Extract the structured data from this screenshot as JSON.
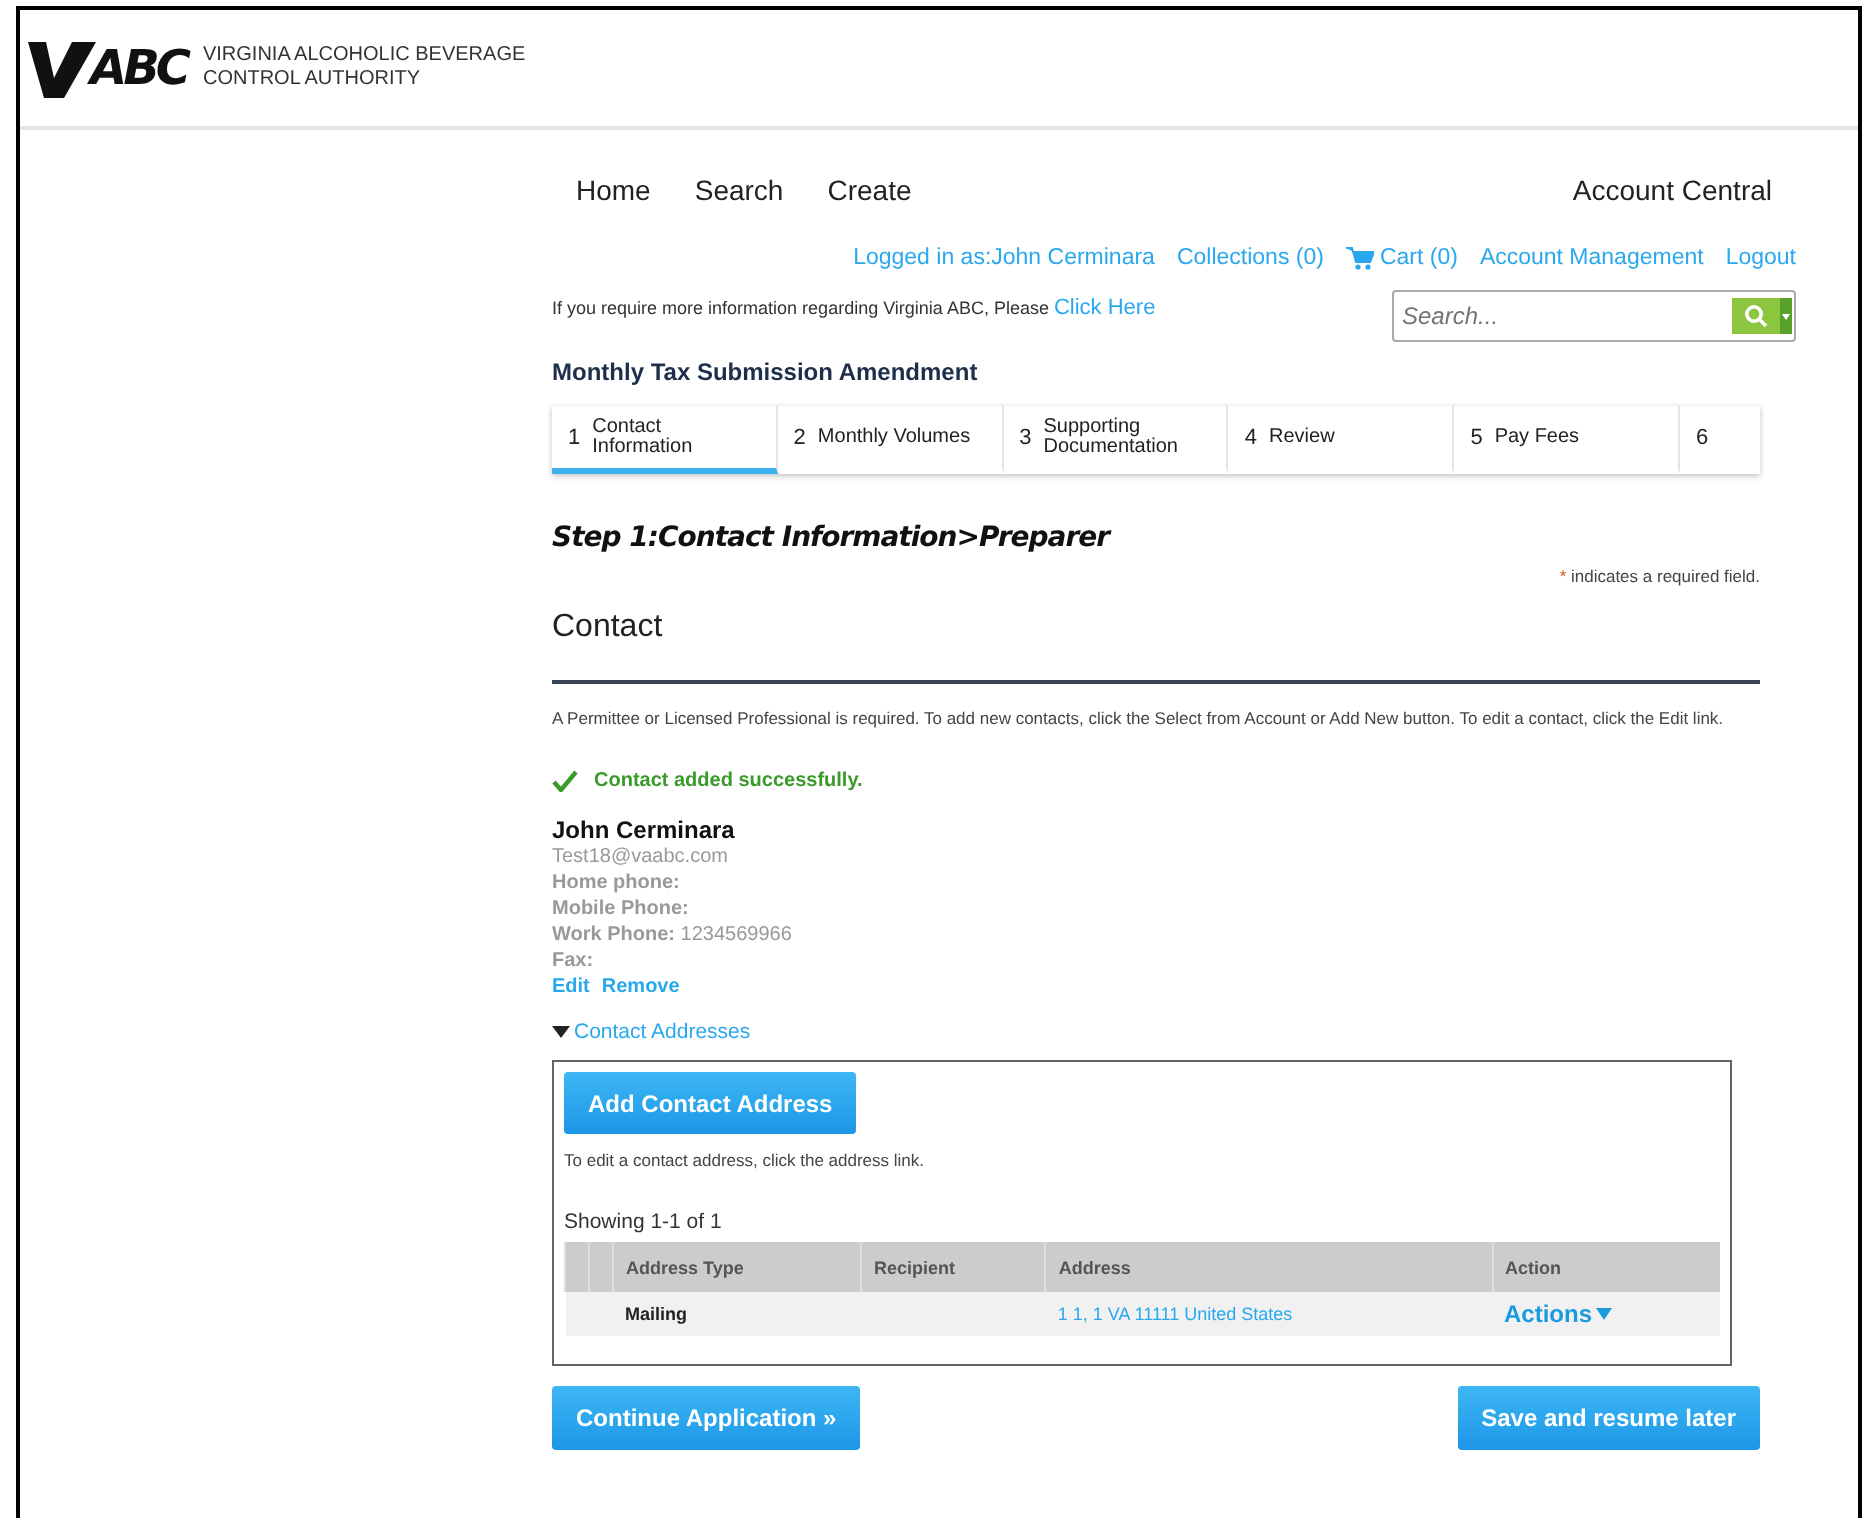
{
  "header": {
    "logo_text": "ABC",
    "org_name": [
      "VIRGINIA ALCOHOLIC BEVERAGE",
      "CONTROL AUTHORITY"
    ]
  },
  "nav": {
    "items": [
      "Home",
      "Search",
      "Create"
    ],
    "account_central": "Account Central"
  },
  "user_links": [
    {
      "kind": "link",
      "label": "Logged in as:John Cerminara"
    },
    {
      "kind": "link",
      "label": "Collections (0)"
    },
    {
      "kind": "cart",
      "label": "Cart (0)"
    },
    {
      "kind": "link",
      "label": "Account Management"
    },
    {
      "kind": "link",
      "label": "Logout"
    }
  ],
  "info": {
    "text": "If you require more information regarding Virginia ABC, Please",
    "link": "Click Here"
  },
  "search": {
    "placeholder": "Search..."
  },
  "page_title": "Monthly Tax Submission Amendment",
  "steps": [
    {
      "number": "1",
      "label": "Contact Information",
      "selected": true
    },
    {
      "number": "2",
      "label": "Monthly Volumes",
      "selected": false
    },
    {
      "number": "3",
      "label": "Supporting Documentation",
      "selected": false
    },
    {
      "number": "4",
      "label": "Review",
      "selected": false
    },
    {
      "number": "5",
      "label": "Pay Fees",
      "selected": false
    },
    {
      "number": "6",
      "selected": false
    }
  ],
  "step_heading": "Step 1:Contact Information>Preparer",
  "required_note": {
    "mark": "*",
    "text": "indicates a required field."
  },
  "section_title": "Contact",
  "instructions": "A Permittee or Licensed Professional is required. To add new contacts, click the Select from Account or Add New button. To edit a contact, click the Edit link.",
  "success_message": "Contact added successfully.",
  "contact": {
    "name": "John  Cerminara",
    "email": "Test18@vaabc.com",
    "fields": [
      {
        "label": "Home phone:"
      },
      {
        "label": "Mobile Phone:"
      },
      {
        "label": "Work Phone:",
        "value": "1234569966"
      },
      {
        "label": "Fax:"
      }
    ],
    "links": [
      "Edit",
      "Remove"
    ]
  },
  "addresses": {
    "label": "Contact Addresses",
    "expanded": true,
    "add_button": "Add Contact Address",
    "hint": "To edit a contact address, click the address link.",
    "showing": "Showing 1-1 of 1",
    "columns": [
      "Address Type",
      "Recipient",
      "Address",
      "Action"
    ],
    "rows": [
      {
        "address_type": "Mailing",
        "address": "1 1, 1 VA 11111 United States",
        "action": "Actions"
      }
    ]
  },
  "buttons": {
    "continue": "Continue Application »",
    "save": "Save and resume later"
  }
}
